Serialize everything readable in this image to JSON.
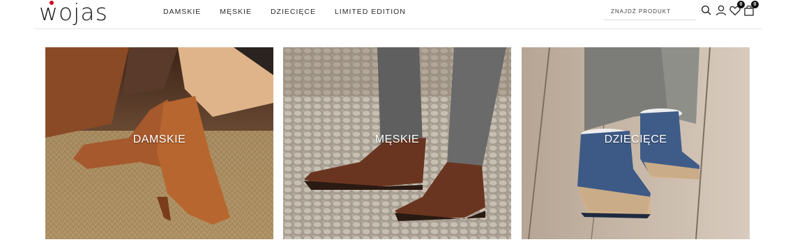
{
  "brand": {
    "logo_text": "wojas"
  },
  "nav": {
    "items": [
      {
        "label": "DAMSKIE"
      },
      {
        "label": "MĘSKIE"
      },
      {
        "label": "DZIECIĘCE"
      },
      {
        "label": "LIMITED EDITION"
      }
    ]
  },
  "search": {
    "placeholder": "ZNAJDŹ PRODUKT"
  },
  "header_icons": {
    "search": "search-icon",
    "account": "user-icon",
    "wishlist": {
      "icon": "heart-icon",
      "count": "0"
    },
    "cart": {
      "icon": "bag-icon",
      "count": "0"
    }
  },
  "tiles": [
    {
      "label": "DAMSKIE"
    },
    {
      "label": "MĘSKIE"
    },
    {
      "label": "DZIECIĘCE"
    }
  ],
  "colors": {
    "accent": "#d0021b",
    "text": "#1c1c1c",
    "badge": "#111111"
  }
}
